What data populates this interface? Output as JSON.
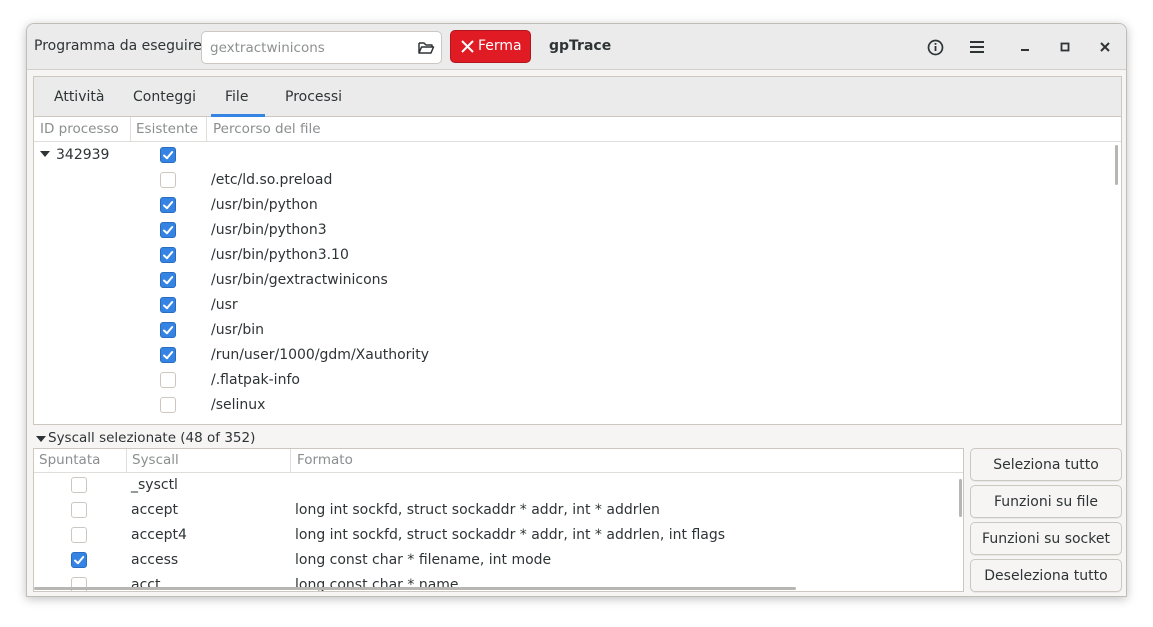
{
  "header": {
    "program_label": "Programma da eseguire:",
    "program_placeholder": "gextractwinicons",
    "stop_label": "Ferma",
    "app_title": "gpTrace"
  },
  "tabs": [
    {
      "label": "Attività"
    },
    {
      "label": "Conteggi"
    },
    {
      "label": "File",
      "active": true
    },
    {
      "label": "Processi"
    }
  ],
  "files_table": {
    "columns": [
      "ID processo",
      "Esistente",
      "Percorso del file"
    ],
    "process_id": "342939",
    "process_exists": true,
    "rows": [
      {
        "exists": false,
        "path": "/etc/ld.so.preload"
      },
      {
        "exists": true,
        "path": "/usr/bin/python"
      },
      {
        "exists": true,
        "path": "/usr/bin/python3"
      },
      {
        "exists": true,
        "path": "/usr/bin/python3.10"
      },
      {
        "exists": true,
        "path": "/usr/bin/gextractwinicons"
      },
      {
        "exists": true,
        "path": "/usr"
      },
      {
        "exists": true,
        "path": "/usr/bin"
      },
      {
        "exists": true,
        "path": "/run/user/1000/gdm/Xauthority"
      },
      {
        "exists": false,
        "path": "/.flatpak-info"
      },
      {
        "exists": false,
        "path": "/selinux"
      }
    ]
  },
  "syscalls": {
    "title": "Syscall selezionate (48 of 352)",
    "columns": [
      "Spuntata",
      "Syscall",
      "Formato"
    ],
    "rows": [
      {
        "checked": false,
        "name": "_sysctl",
        "format": ""
      },
      {
        "checked": false,
        "name": "accept",
        "format": "long int sockfd, struct sockaddr * addr, int * addrlen"
      },
      {
        "checked": false,
        "name": "accept4",
        "format": "long int sockfd, struct sockaddr * addr, int * addrlen, int flags"
      },
      {
        "checked": true,
        "name": "access",
        "format": "long const char * filename, int mode"
      },
      {
        "checked": false,
        "name": "acct",
        "format": "long const char * name"
      }
    ]
  },
  "side_buttons": {
    "select_all": "Seleziona tutto",
    "file_functions": "Funzioni su file",
    "socket_functions": "Funzioni su socket",
    "deselect_all": "Deseleziona tutto"
  },
  "colors": {
    "accent": "#3584e4",
    "destructive": "#e01b24"
  }
}
